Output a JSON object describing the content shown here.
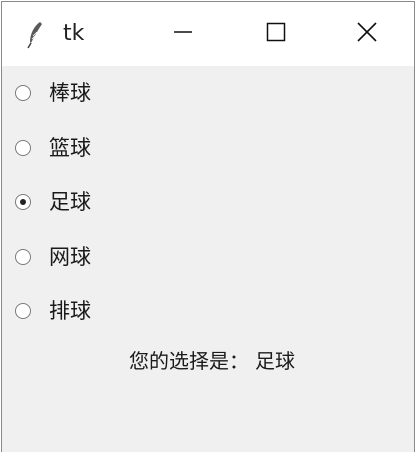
{
  "window": {
    "title": "tk",
    "icon": "feather-icon",
    "controls": [
      "minimize-icon",
      "maximize-icon",
      "close-icon"
    ]
  },
  "radios": [
    {
      "label": "棒球",
      "checked": false
    },
    {
      "label": "篮球",
      "checked": false
    },
    {
      "label": "足球",
      "checked": true
    },
    {
      "label": "网球",
      "checked": false
    },
    {
      "label": "排球",
      "checked": false
    }
  ],
  "result": {
    "prefix": "您的选择是：",
    "value": "足球"
  },
  "colors": {
    "window_bg": "#f0f0f0",
    "titlebar_bg": "#ffffff",
    "text": "#1a1a1a"
  }
}
